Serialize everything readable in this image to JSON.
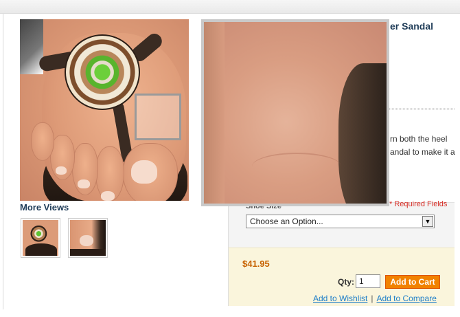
{
  "product": {
    "title_visible": "er Sandal",
    "description_lines": [
      "rn both the heel",
      "andal to make it a"
    ]
  },
  "gallery": {
    "more_views_label": "More Views",
    "thumbnails": [
      "sandal-medallion-thumb",
      "toe-closeup-thumb"
    ]
  },
  "options": {
    "shoe_size_label": "Shoe Size",
    "required_text": "* Required Fields",
    "select_value": "Choose an Option..."
  },
  "purchase": {
    "price": "$41.95",
    "qty_label": "Qty:",
    "qty_value": "1",
    "add_to_cart": "Add to Cart",
    "wishlist_link": "Add to Wishlist",
    "separator": "|",
    "compare_link": "Add to Compare"
  },
  "colors": {
    "accent_orange": "#f18200",
    "price_color": "#c76200",
    "link_blue": "#1e7ec8",
    "title_navy": "#1e3b57",
    "required_red": "#d72a22"
  }
}
